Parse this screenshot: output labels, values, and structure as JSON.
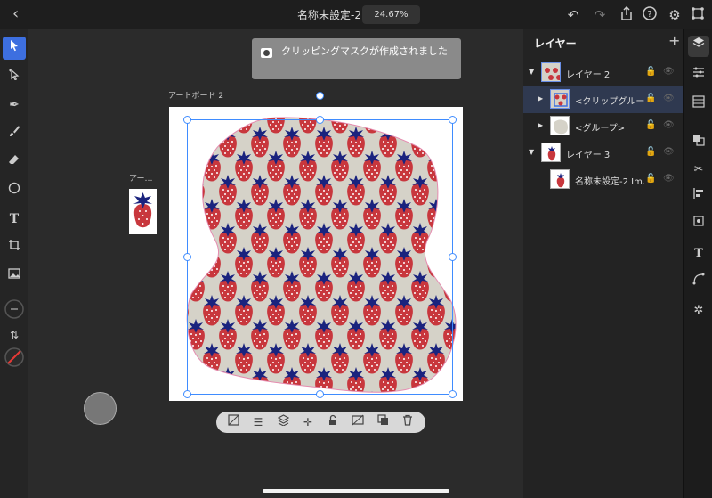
{
  "header": {
    "title": "名称未設定-2",
    "zoom": "24.67%",
    "back_icon": "chevron-left-icon",
    "undo_icon": "undo-icon",
    "redo_icon": "redo-icon",
    "share_icon": "share-icon",
    "help_icon": "help-icon",
    "settings_icon": "gear-icon",
    "fullscreen_icon": "fullscreen-icon"
  },
  "tools": [
    "select",
    "direct-select",
    "pen",
    "brush",
    "eraser",
    "shape",
    "type",
    "crop",
    "image",
    "stroke-width",
    "swap",
    "fill-color"
  ],
  "canvas": {
    "toast": "クリッピングマスクが作成されました",
    "artboard_label": "アートボード 2",
    "mini_artboard_label": "アー…"
  },
  "layers": {
    "title": "レイヤー",
    "add_label": "+",
    "items": [
      {
        "name": "レイヤー 2",
        "level": 0,
        "expanded": true
      },
      {
        "name": "<クリップグルー…",
        "level": 1,
        "selected": true
      },
      {
        "name": "<グループ>",
        "level": 1
      },
      {
        "name": "レイヤー 3",
        "level": 0,
        "expanded": true
      },
      {
        "name": "名称未設定-2 Im…",
        "level": 1
      }
    ]
  },
  "colors": {
    "accent": "#3d6fe0",
    "strawberry": "#c8373d",
    "leaf": "#1a237e",
    "pattern_bg": "#d5d2c8"
  }
}
